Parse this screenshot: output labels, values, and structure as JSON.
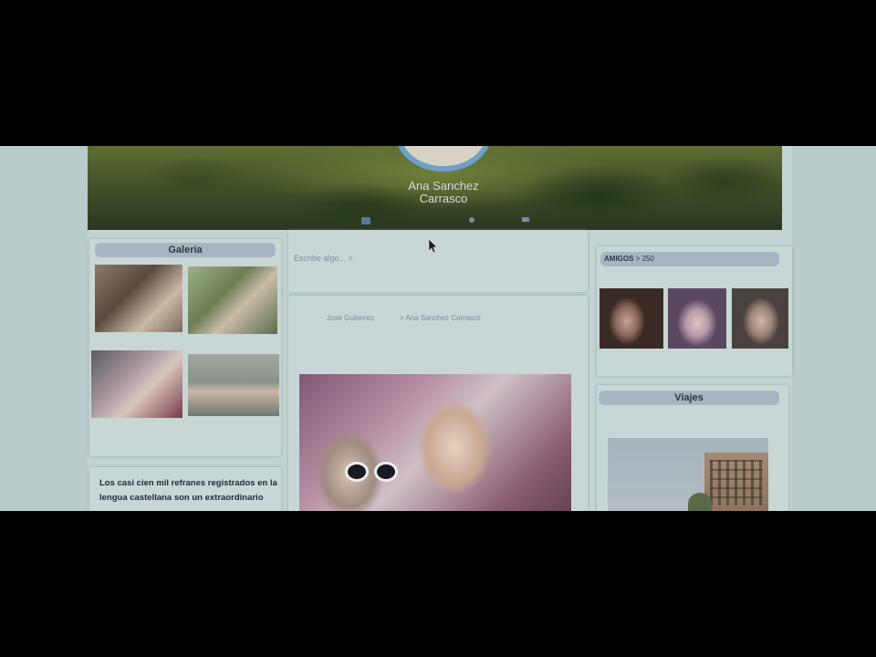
{
  "profile": {
    "name_line1": "Ana Sanchez",
    "name_line2": "Carrasco"
  },
  "gallery": {
    "title": "Galeria"
  },
  "proverbs": {
    "text": "Los casi cien mil refranes registrados en la lengua castellana son un extraordinario"
  },
  "post": {
    "input_placeholder": "Escribe algo... >",
    "author": "Jose Gutierrez",
    "recipient": "> Ana Sanchez Carrasco"
  },
  "friends": {
    "label": "AMIGOS",
    "count": "> 250"
  },
  "travel": {
    "title": "Viajes"
  },
  "colors": {
    "accent_ring": "#6fa0c7",
    "header_pill": "#a9b4c3",
    "page_background": "#c3d3d1"
  }
}
